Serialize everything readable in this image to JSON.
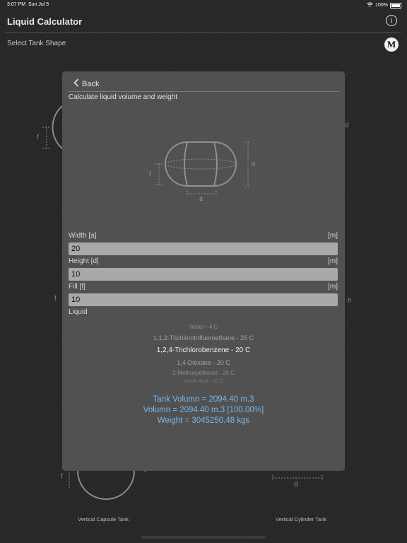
{
  "status": {
    "time": "3:07 PM",
    "date": "Sun Jul 5",
    "battery": "100%"
  },
  "header": {
    "title": "Liquid Calculator",
    "info_icon": "i",
    "subtitle": "Select Tank Shape",
    "m_badge": "M"
  },
  "background": {
    "labels": {
      "vertical_capsule": "Vertical Capsule Tank",
      "vertical_cylinder": "Vertical Cylinder Tank"
    },
    "letters": {
      "f1": "f",
      "d1": "d",
      "f2": "f",
      "h": "h",
      "f3": "f",
      "d2": "d"
    }
  },
  "modal": {
    "back_label": "Back",
    "title": "Calculate liquid volume and weight",
    "diagram_labels": {
      "f": "f",
      "d": "d",
      "a": "a"
    },
    "fields": {
      "width": {
        "label": "Width [a]",
        "unit": "[m]",
        "value": "20"
      },
      "height": {
        "label": "Height [d]",
        "unit": "[m]",
        "value": "10"
      },
      "fill": {
        "label": "Fill [f]",
        "unit": "[m]",
        "value": "10"
      }
    },
    "liquid_label": "Liquid",
    "liquid_options": [
      "Water - 4 C",
      "1,1,2-Trichlorotrifluoroethane - 25 C",
      "1,2,4-Trichlorobenzene - 20 C",
      "1,4-Dioxane - 20 C",
      "2-Methoxyethanol - 20 C",
      "Acetic Acid - 20 C"
    ],
    "selected_liquid": "1,2,4-Trichlorobenzene - 20 C",
    "results": {
      "tank_volume": "Tank Volumn = 2094.40 m.3",
      "volume": "Volumn = 2094.40 m.3 [100.00%]",
      "weight": "Weight = 3045250.48 kgs"
    }
  }
}
